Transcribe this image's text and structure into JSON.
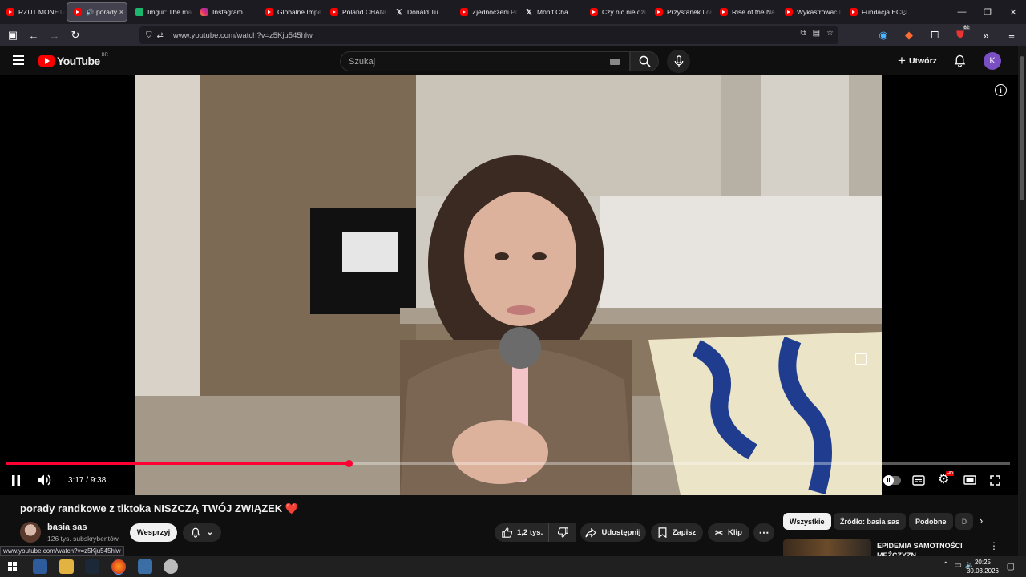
{
  "browser": {
    "tabs": [
      {
        "label": "RZUT MONETĄ",
        "icon": "youtube-icon"
      },
      {
        "label": "porady",
        "icon": "youtube-icon",
        "audio": "🔊",
        "close": "×"
      },
      {
        "label": "Imgur: The ma",
        "icon": "imgur-icon"
      },
      {
        "label": "Instagram",
        "icon": "instagram-icon"
      },
      {
        "label": "Globalne Impe",
        "icon": "youtube-icon"
      },
      {
        "label": "Poland CHANG",
        "icon": "youtube-icon"
      },
      {
        "label": "Donald Tu",
        "icon": "x-icon"
      },
      {
        "label": "Zjednoczeni Pr",
        "icon": "youtube-icon"
      },
      {
        "label": "Mohit Cha",
        "icon": "x-icon"
      },
      {
        "label": "Czy nic nie dzi",
        "icon": "youtube-icon"
      },
      {
        "label": "Przystanek Lor",
        "icon": "youtube-icon"
      },
      {
        "label": "Rise of the Na",
        "icon": "youtube-icon"
      },
      {
        "label": "Wykastrować l",
        "icon": "youtube-icon"
      },
      {
        "label": "Fundacja ECPU",
        "icon": "youtube-icon"
      }
    ],
    "url": "www.youtube.com/watch?v=z5Kju545hlw",
    "status_url": "www.youtube.com/watch?v=z5Kju545hlw",
    "extension_badge": "62"
  },
  "youtube": {
    "logo_text": "YouTube",
    "logo_country": "BR",
    "search_placeholder": "Szukaj",
    "create_label": "Utwórz",
    "avatar_letter": "K"
  },
  "player": {
    "current_time": "3:17",
    "duration": "9:38",
    "time_separator": " / ",
    "progress_fraction": 0.341,
    "buffered_fraction": 1.0,
    "settings_badge": "HD"
  },
  "video": {
    "title": "porady randkowe z tiktoka NISZCZĄ TWÓJ ZWIĄZEK",
    "title_emoji": "❤️",
    "channel": "basia sas",
    "subscribers": "126 tys. subskrybentów",
    "support_label": "Wesprzyj",
    "likes": "1,2 tys.",
    "share_label": "Udostępnij",
    "save_label": "Zapisz",
    "clip_label": "Klip"
  },
  "sidebar": {
    "chips": [
      "Wszystkie",
      "Źródło: basia sas",
      "Podobne",
      "D"
    ],
    "recommended": [
      {
        "title": "EPIDEMIA SAMOTNOŚCI MĘŻCZYZN"
      }
    ]
  },
  "taskbar": {
    "time": "20:25",
    "date": "30.03.2026"
  },
  "colors": {
    "accent_red": "#ff0033",
    "background": "#0f0f0f"
  }
}
